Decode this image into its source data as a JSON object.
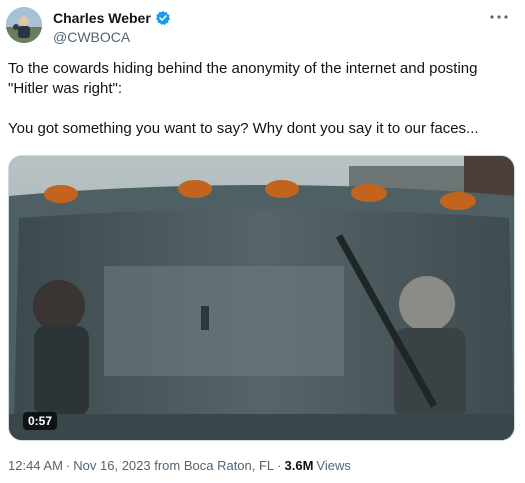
{
  "author": {
    "display_name": "Charles Weber",
    "handle": "@CWBOCA",
    "verified_color": "#1d9bf0"
  },
  "tweet": {
    "line1": "To the cowards hiding behind the anonymity of the internet and posting \"Hitler was right\":",
    "line2": "You got something you want to say? Why dont you say it to our faces..."
  },
  "media": {
    "duration": "0:57"
  },
  "meta": {
    "time": "12:44 AM",
    "dot": "·",
    "date": "Nov 16, 2023 from Boca Raton, FL",
    "views_count": "3.6M",
    "views_label": "Views"
  },
  "icons": {
    "more": "more-horizontal-icon",
    "verified": "verified-badge-icon"
  }
}
